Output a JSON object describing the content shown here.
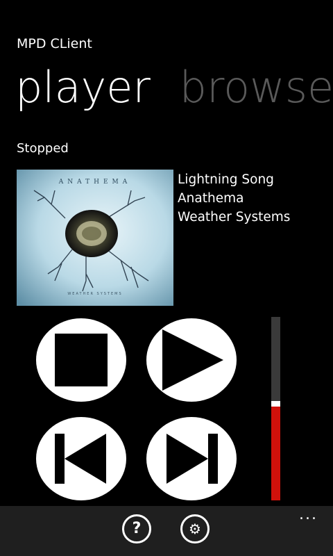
{
  "app": {
    "title": "MPD CLient"
  },
  "pivot": {
    "items": [
      "player",
      "browse"
    ],
    "selected": "player"
  },
  "player": {
    "status": "Stopped",
    "track": {
      "title": "Lightning Song",
      "artist": "Anathema",
      "album": "Weather Systems"
    },
    "album_art": {
      "label": "ANATHEMA",
      "caption": "WEATHER SYSTEMS"
    },
    "volume_fraction": 0.51
  },
  "controls": {
    "stop": {
      "icon": "stop-icon"
    },
    "play": {
      "icon": "play-icon"
    },
    "previous": {
      "icon": "skip-previous-icon"
    },
    "next": {
      "icon": "skip-next-icon"
    }
  },
  "app_bar": {
    "buttons": [
      {
        "icon": "help-icon",
        "glyph": "?"
      },
      {
        "icon": "settings-icon",
        "glyph": "⚙"
      }
    ],
    "more": "..."
  },
  "colors": {
    "background": "#000000",
    "accent": "#d0110b",
    "inactive": "#5a5a5a"
  }
}
